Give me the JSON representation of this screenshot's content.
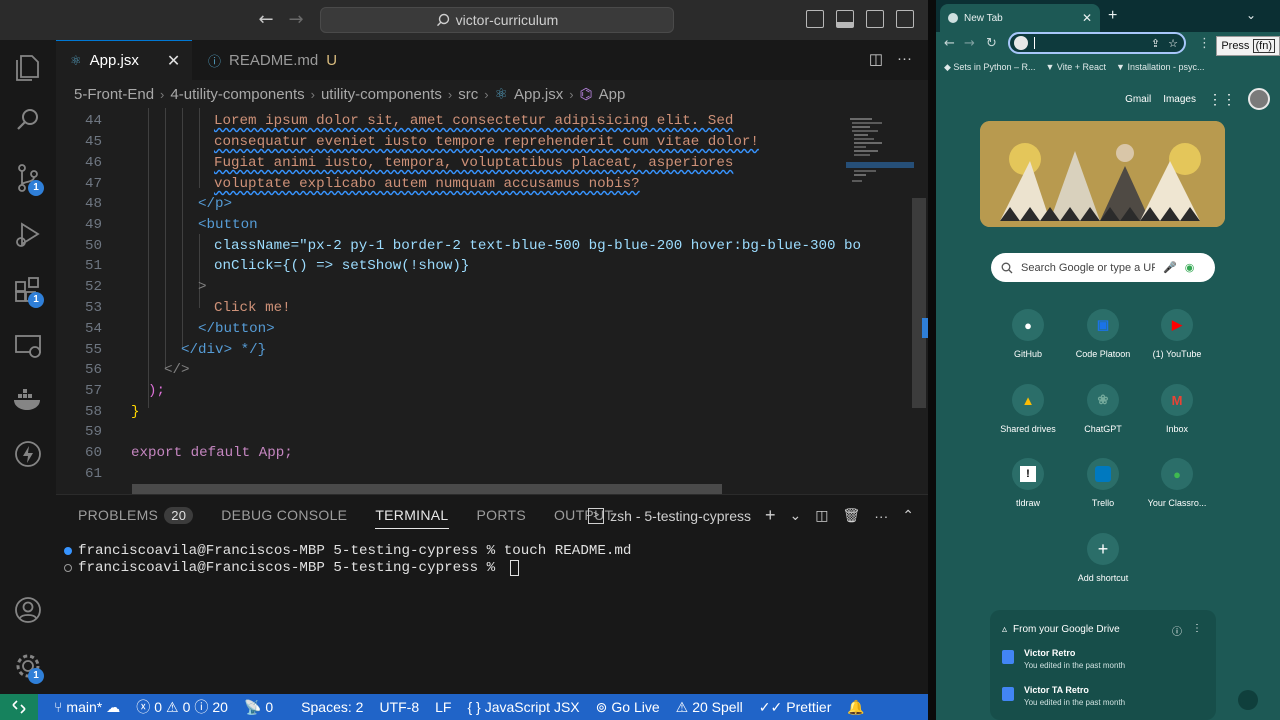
{
  "vscode": {
    "command_center": "victor-curriculum",
    "tabs": [
      {
        "label": "App.jsx",
        "close": "✕"
      },
      {
        "label": "README.md",
        "status": "U"
      }
    ],
    "breadcrumbs": [
      "5-Front-End",
      "4-utility-components",
      "utility-components",
      "src",
      "App.jsx",
      "App"
    ],
    "activity_badges": {
      "source_control": "1",
      "extensions": "1",
      "manage": "1"
    },
    "code_lines": [
      {
        "n": "44",
        "text": "Lorem ipsum dolor sit, amet consectetur adipisicing elit. Sed"
      },
      {
        "n": "45",
        "text": "consequatur eveniet iusto tempore reprehenderit cum vitae dolor!"
      },
      {
        "n": "46",
        "text": "Fugiat animi iusto, tempora, voluptatibus placeat, asperiores"
      },
      {
        "n": "47",
        "text": "voluptate explicabo autem numquam accusamus nobis?"
      },
      {
        "n": "48",
        "text": "</p>"
      },
      {
        "n": "49",
        "text": "<button"
      },
      {
        "n": "50",
        "text": "className=\"px-2 py-1 border-2 text-blue-500 bg-blue-200 hover:bg-blue-300 bo"
      },
      {
        "n": "51",
        "text": "onClick={() => setShow(!show)}"
      },
      {
        "n": "52",
        "text": ">"
      },
      {
        "n": "53",
        "text": "Click me!"
      },
      {
        "n": "54",
        "text": "</button>"
      },
      {
        "n": "55",
        "text": "</div> */}"
      },
      {
        "n": "56",
        "text": "</>"
      },
      {
        "n": "57",
        "text": ");"
      },
      {
        "n": "58",
        "text": "}"
      },
      {
        "n": "59",
        "text": ""
      },
      {
        "n": "60",
        "text": "export default App;"
      },
      {
        "n": "61",
        "text": ""
      }
    ],
    "panel": {
      "tabs": [
        "PROBLEMS",
        "DEBUG CONSOLE",
        "TERMINAL",
        "PORTS",
        "OUTPUT"
      ],
      "problems_count": "20",
      "active_tab": "TERMINAL",
      "terminal_name": "zsh - 5-testing-cypress",
      "lines": [
        "franciscoavila@Franciscos-MBP 5-testing-cypress % touch README.md",
        "franciscoavila@Franciscos-MBP 5-testing-cypress % "
      ]
    },
    "status_bar": {
      "branch": "main*",
      "errors": "0",
      "warnings": "0",
      "infos": "20",
      "ports": "0",
      "spaces": "Spaces: 2",
      "encoding": "UTF-8",
      "eol": "LF",
      "language": "JavaScript JSX",
      "golive": "Go Live",
      "spell": "20 Spell",
      "prettier": "Prettier"
    },
    "colors": {
      "accent": "#2064c8",
      "remote": "#16825d"
    }
  },
  "chrome": {
    "tab_title": "New Tab",
    "tooltip": "Press",
    "tooltip_key": "(fn)",
    "bookmarks": [
      "Sets in Python – R...",
      "Vite + React",
      "Installation - psyc..."
    ],
    "top_links": [
      "Gmail",
      "Images"
    ],
    "search_placeholder": "Search Google or type a URL",
    "shortcuts": [
      {
        "label": "GitHub",
        "icon": "github-icon"
      },
      {
        "label": "Code Platoon",
        "icon": "code-platoon-icon"
      },
      {
        "label": "(1) YouTube",
        "icon": "youtube-icon"
      },
      {
        "label": "Shared drives",
        "icon": "drive-icon"
      },
      {
        "label": "ChatGPT",
        "icon": "chatgpt-icon"
      },
      {
        "label": "Inbox",
        "icon": "gmail-icon"
      },
      {
        "label": "tldraw",
        "icon": "tldraw-icon"
      },
      {
        "label": "Trello",
        "icon": "trello-icon"
      },
      {
        "label": "Your Classro...",
        "icon": "github-icon"
      },
      {
        "label": "Add shortcut",
        "icon": "plus-icon"
      }
    ],
    "drive_card": {
      "title": "From your Google Drive",
      "items": [
        {
          "name": "Victor Retro",
          "sub": "You edited in the past month"
        },
        {
          "name": "Victor TA Retro",
          "sub": "You edited in the past month"
        }
      ]
    }
  }
}
